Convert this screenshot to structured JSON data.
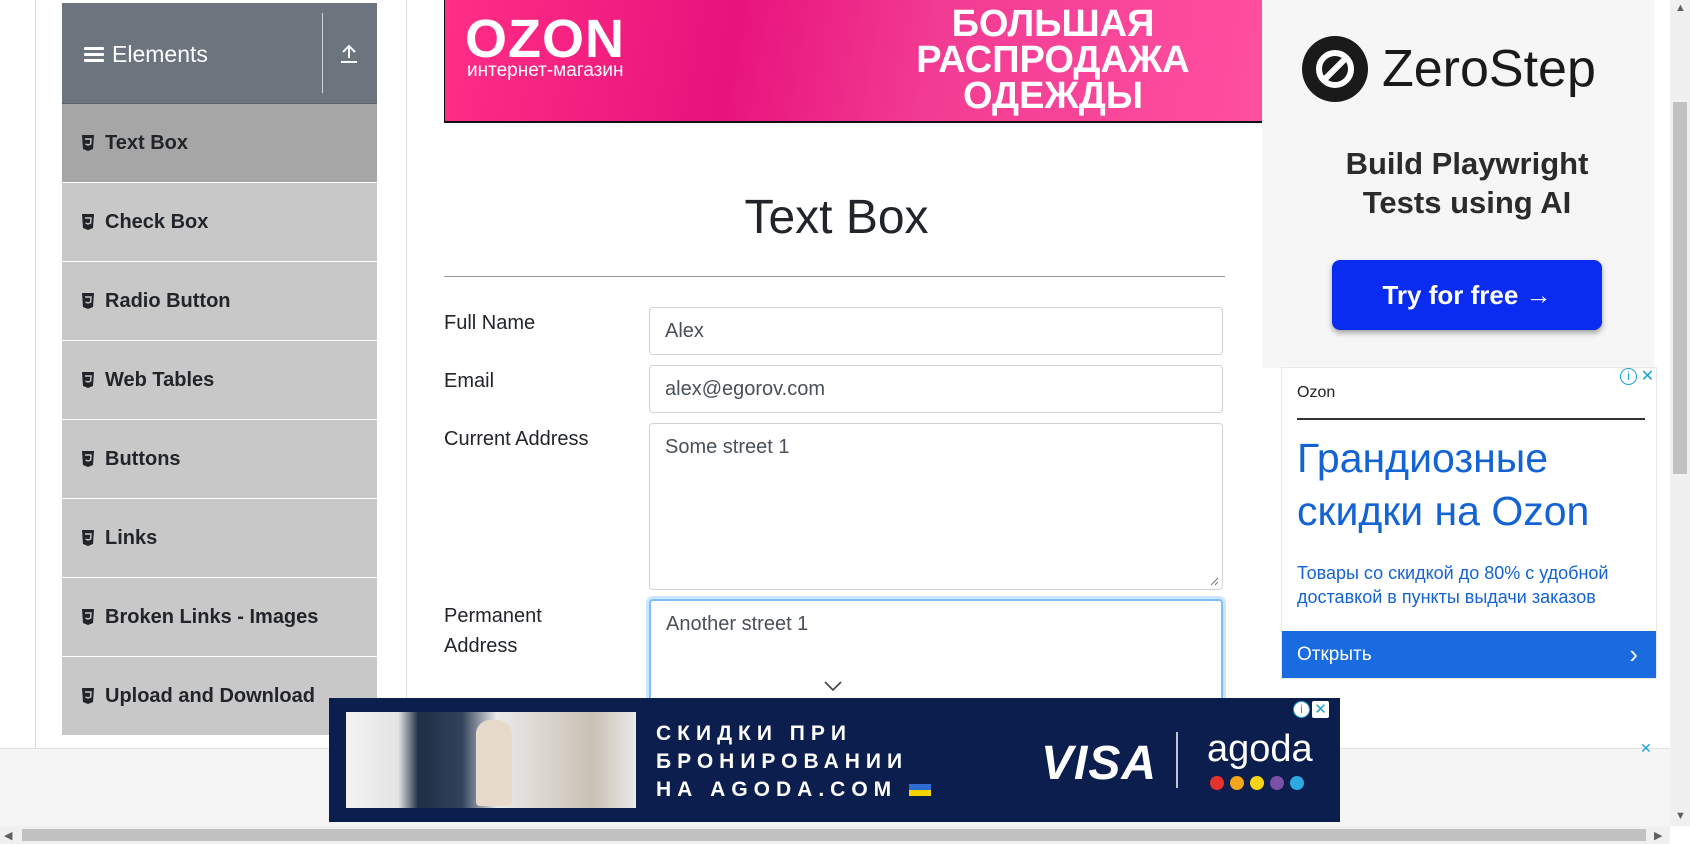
{
  "sidebar": {
    "header": "Elements",
    "items": [
      {
        "label": "Text Box"
      },
      {
        "label": "Check Box"
      },
      {
        "label": "Radio Button"
      },
      {
        "label": "Web Tables"
      },
      {
        "label": "Buttons"
      },
      {
        "label": "Links"
      },
      {
        "label": "Broken Links - Images"
      },
      {
        "label": "Upload and Download"
      }
    ]
  },
  "top_banner": {
    "brand": "OZON",
    "tagline": "интернет-магазин",
    "line1": "БОЛЬШАЯ",
    "line2": "РАСПРОДАЖА",
    "line3": "ОДЕЖДЫ"
  },
  "form": {
    "title": "Text Box",
    "full_name_label": "Full Name",
    "full_name_value": "Alex",
    "email_label": "Email",
    "email_value": "alex@egorov.com",
    "current_address_label": "Current Address",
    "current_address_value": "Some street 1",
    "permanent_address_label_1": "Permanent",
    "permanent_address_label_2": "Address",
    "permanent_address_value": "Another street 1"
  },
  "ad_zerostep": {
    "brand": "ZeroStep",
    "line1": "Build Playwright",
    "line2": "Tests using AI",
    "button": "Try for free →"
  },
  "ad_ozon": {
    "brand": "Ozon",
    "headline_1": "Грандиозные",
    "headline_2": "скидки на Ozon",
    "description": "Товары со скидкой до 80% с удобной доставкой в пункты выдачи заказов",
    "button": "Открыть"
  },
  "ad_bottom": {
    "line1": "СКИДКИ ПРИ",
    "line2": "БРОНИРОВАНИИ",
    "line3": "НА AGODA.COM",
    "visa": "VISA",
    "agoda": "agoda"
  },
  "colors": {
    "sidebar_header": "#6c757d",
    "sidebar_item": "#c8c8c8",
    "sidebar_active": "#a6a6a6",
    "ozon_blue": "#1463d6",
    "zerostep_button": "#0a2bf0",
    "agoda_bg": "#0b1e4e",
    "agoda_dots": [
      "#e5322d",
      "#f4a51c",
      "#f7d516",
      "#7b4fa3",
      "#2da8e0"
    ]
  }
}
